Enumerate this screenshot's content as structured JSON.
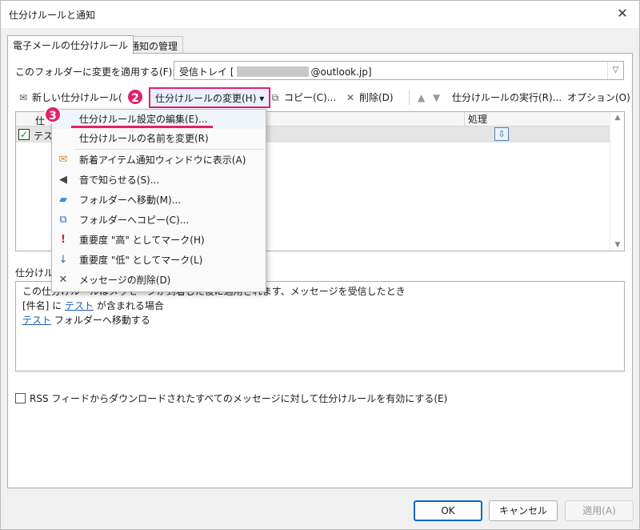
{
  "window": {
    "title": "仕分けルールと通知",
    "close_glyph": "✕"
  },
  "tabs": [
    {
      "label": "電子メールの仕分けルール"
    },
    {
      "label": "通知の管理"
    }
  ],
  "folder": {
    "label": "このフォルダーに変更を適用する(F):",
    "value_prefix": "受信トレイ [",
    "value_suffix": "@outlook.jp]",
    "arrow_glyph": "▽"
  },
  "toolbar": {
    "new_rule": "新しい仕分けルール(",
    "change_rule": "仕分けルールの変更(H)",
    "change_arrow": "▾",
    "copy": "コピー(C)...",
    "delete": "削除(D)",
    "up_glyph": "▲",
    "down_glyph": "▼",
    "run": "仕分けルールの実行(R)...",
    "options": "オプション(O)"
  },
  "rules_list": {
    "col_name": "仕",
    "col_action": "処理",
    "rows": [
      {
        "name": "テス",
        "checked_glyph": "✓"
      }
    ],
    "scroll_up": "▲",
    "scroll_down": "▼"
  },
  "description": {
    "label": "仕分けル",
    "line1": "この仕分けルールはメッセージが到着した後に適用されます、メッセージを受信したとき",
    "line2_prefix": "[件名] に ",
    "line2_link": "テスト",
    "line2_suffix": " が含まれる場合",
    "line3_link": "テスト",
    "line3_suffix": " フォルダーへ移動する"
  },
  "rss_checkbox": "RSS フィードからダウンロードされたすべてのメッセージに対して仕分けルールを有効にする(E)",
  "buttons": {
    "ok": "OK",
    "cancel": "キャンセル",
    "apply": "適用(A)"
  },
  "menu": {
    "items": [
      {
        "label": "仕分けルール設定の編集(E)...",
        "icon": ""
      },
      {
        "label": "仕分けルールの名前を変更(R)",
        "icon": ""
      },
      {
        "label": "新着アイテム通知ウィンドウに表示(A)",
        "icon": "envelope-icon"
      },
      {
        "label": "音で知らせる(S)...",
        "icon": "speaker-icon"
      },
      {
        "label": "フォルダーへ移動(M)...",
        "icon": "folder-icon"
      },
      {
        "label": "フォルダーへコピー(C)...",
        "icon": "copy-folder-icon"
      },
      {
        "label": "重要度 \"高\" としてマーク(H)",
        "icon": "exclamation-icon"
      },
      {
        "label": "重要度 \"低\" としてマーク(L)",
        "icon": "down-arrow-icon"
      },
      {
        "label": "メッセージの削除(D)",
        "icon": "x-icon"
      }
    ]
  },
  "badges": {
    "step2": "2",
    "step3": "3"
  },
  "colors": {
    "highlight": "#e5206b",
    "link": "#1a5fb4"
  }
}
